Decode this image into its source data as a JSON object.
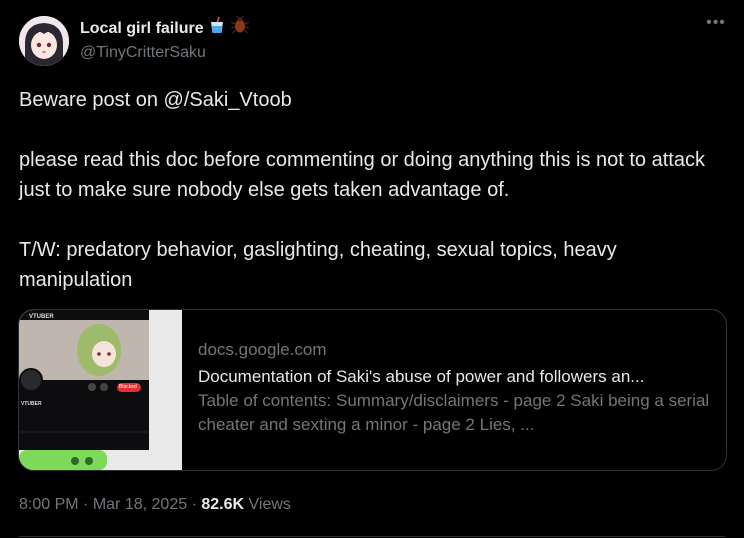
{
  "author": {
    "display_name": "Local girl failure",
    "emoji_1": "cup-with-straw-icon",
    "emoji_2": "cockroach-icon",
    "handle": "@TinyCritterSaku"
  },
  "more_label": "•••",
  "post": {
    "line_1": "Beware post on @/Saki_Vtoob",
    "line_2": "please read this doc before commenting or doing anything this is not to attack just to make sure nobody else gets taken advantage of.",
    "line_3": "T/W: predatory behavior, gaslighting, cheating, sexual topics, heavy manipulation"
  },
  "card": {
    "domain": "docs.google.com",
    "title": "Documentation of Saki's abuse of power and followers an...",
    "description": "Table of contents: Summary/disclaimers - page 2 Saki being a serial cheater and sexting a minor - page 2 Lies, ...",
    "thumb_label": "VTUBER",
    "thumb_label_2": "VTUBER",
    "thumb_button": "Blocked"
  },
  "meta": {
    "time": "8:00 PM",
    "sep": "·",
    "date": "Mar 18, 2025",
    "views_count": "82.6K",
    "views_label": "Views"
  },
  "colors": {
    "background": "#000000",
    "text": "#e7e9ea",
    "muted": "#71767b",
    "border": "#2f3336"
  }
}
